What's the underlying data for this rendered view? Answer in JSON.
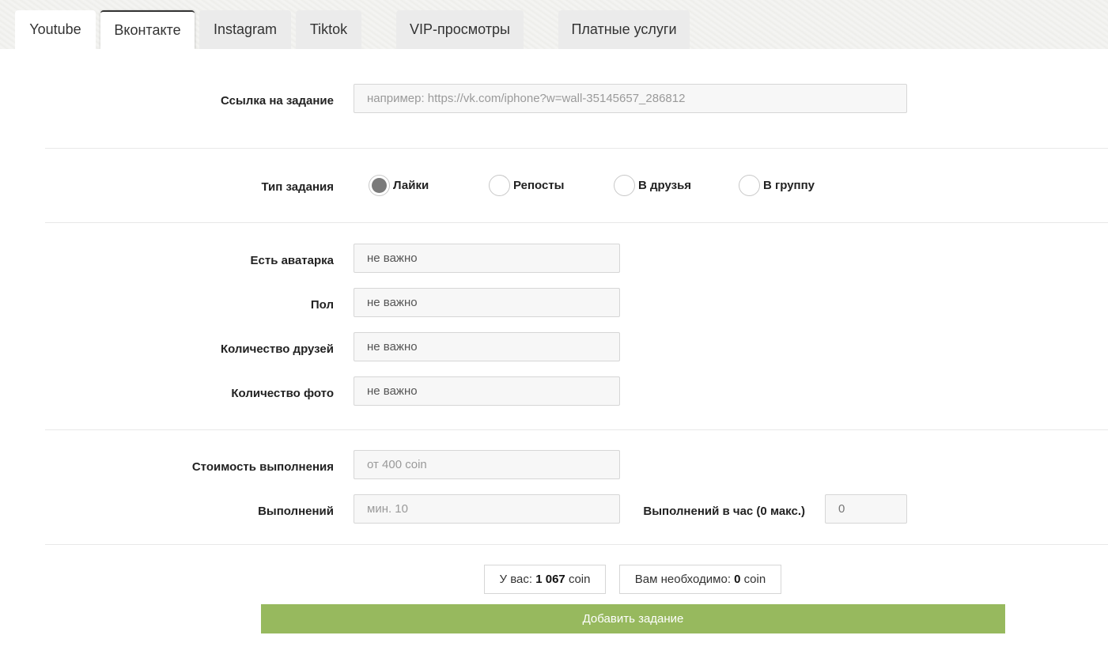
{
  "tabs": [
    {
      "label": "Youtube"
    },
    {
      "label": "Вконтакте"
    },
    {
      "label": "Instagram"
    },
    {
      "label": "Tiktok"
    },
    {
      "label": "VIP-просмотры"
    },
    {
      "label": "Платные услуги"
    }
  ],
  "active_tab": "Вконтакте",
  "form": {
    "link": {
      "label": "Ссылка на задание",
      "placeholder": "например: https://vk.com/iphone?w=wall-35145657_286812",
      "value": ""
    },
    "task_type": {
      "label": "Тип задания",
      "options": [
        "Лайки",
        "Репосты",
        "В друзья",
        "В группу"
      ],
      "selected": "Лайки"
    },
    "avatar": {
      "label": "Есть аватарка",
      "value": "не важно"
    },
    "gender": {
      "label": "Пол",
      "value": "не важно"
    },
    "friends": {
      "label": "Количество друзей",
      "value": "не важно"
    },
    "photos": {
      "label": "Количество фото",
      "value": "не важно"
    },
    "cost": {
      "label": "Стоимость выполнения",
      "placeholder": "от 400 coin"
    },
    "executions": {
      "label": "Выполнений",
      "placeholder": "мин. 10"
    },
    "per_hour": {
      "label": "Выполнений в час (0 макс.)",
      "value": "0"
    }
  },
  "balance": {
    "have_prefix": "У вас:",
    "have_amount": "1 067",
    "have_unit": "coin",
    "need_prefix": "Вам необходимо:",
    "need_amount": "0",
    "need_unit": "coin"
  },
  "submit_label": "Добавить задание",
  "colors": {
    "submit": "#97b95e",
    "tab_inactive": "#ebebeb"
  }
}
